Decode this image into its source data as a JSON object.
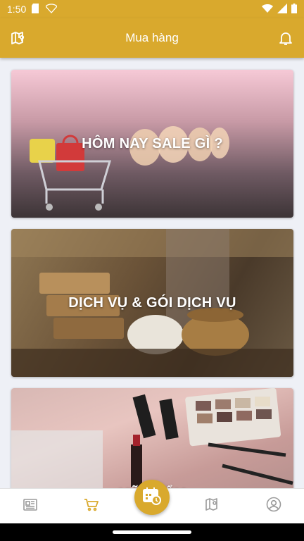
{
  "status_bar": {
    "time": "1:50"
  },
  "app_bar": {
    "title": "Mua hàng"
  },
  "cards": [
    {
      "label": "HÔM NAY SALE GÌ ?"
    },
    {
      "label": "DỊCH VỤ & GÓI DỊCH VỤ"
    },
    {
      "label": "MỸ PHẨM"
    }
  ],
  "bottom_nav": {
    "items": [
      "news-icon",
      "cart-icon",
      "calendar-clock-icon",
      "map-pin-icon",
      "account-icon"
    ],
    "active": "cart-icon"
  },
  "colors": {
    "accent": "#d9a92d",
    "inactive": "#9a9a9a"
  }
}
